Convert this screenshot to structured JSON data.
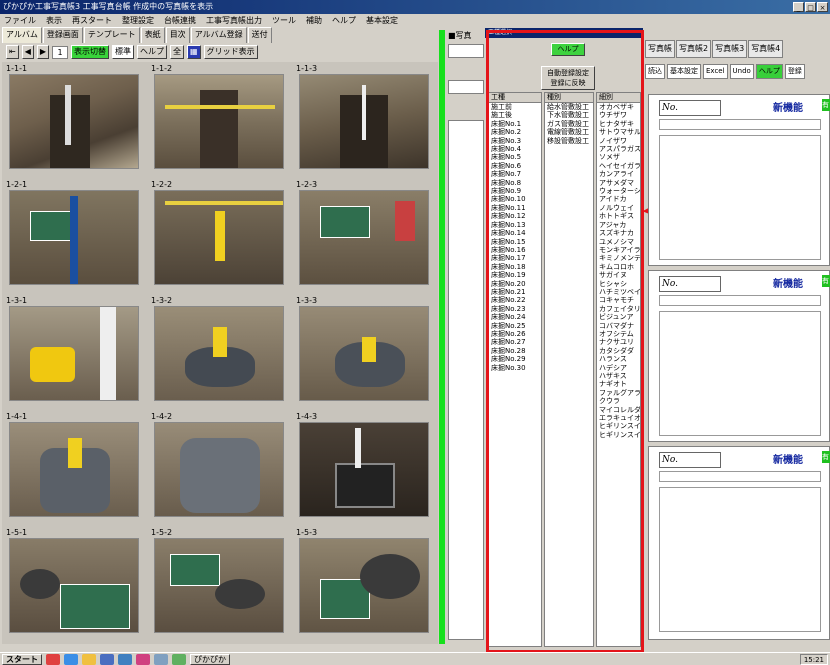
{
  "window": {
    "title": "ぴかぴか工事写真帳3 工事写真台帳 作成中の写真帳を表示"
  },
  "menu": [
    "ファイル",
    "表示",
    "再スタート",
    "整理設定",
    "台帳連携",
    "工事写真帳出力",
    "ツール",
    "補助",
    "ヘルプ",
    "基本設定"
  ],
  "tabs": [
    "アルバム",
    "登録画面",
    "テンプレート",
    "表紙",
    "目次",
    "アルバム登録",
    "送付"
  ],
  "toolbar": {
    "page": "1",
    "green_btn": "表示切替",
    "size": "標準",
    "help": "ヘルプ",
    "all": "全",
    "grid": "グリッド表示"
  },
  "thumbnails": [
    {
      "label": "1-1-1"
    },
    {
      "label": "1-1-2"
    },
    {
      "label": "1-1-3"
    },
    {
      "label": "1-2-1"
    },
    {
      "label": "1-2-2"
    },
    {
      "label": "1-2-3"
    },
    {
      "label": "1-3-1"
    },
    {
      "label": "1-3-2"
    },
    {
      "label": "1-3-3"
    },
    {
      "label": "1-4-1"
    },
    {
      "label": "1-4-2"
    },
    {
      "label": "1-4-3"
    },
    {
      "label": "1-5-1"
    },
    {
      "label": "1-5-2"
    },
    {
      "label": "1-5-3"
    }
  ],
  "mid_panel": {
    "header": "■写真"
  },
  "dialog": {
    "title": "工種選択",
    "help_label": "ヘルプ",
    "auto_label_1": "自動登録設定",
    "auto_label_2": "登録に反映",
    "col1_header": "工種",
    "col2_header": "種別",
    "col3_header": "細別",
    "col1_items": [
      "施工前",
      "施工後",
      "床掘No.1",
      "床掘No.2",
      "床掘No.3",
      "床掘No.4",
      "床掘No.5",
      "床掘No.6",
      "床掘No.7",
      "床掘No.8",
      "床掘No.9",
      "床掘No.10",
      "床掘No.11",
      "床掘No.12",
      "床掘No.13",
      "床掘No.14",
      "床掘No.15",
      "床掘No.16",
      "床掘No.17",
      "床掘No.18",
      "床掘No.19",
      "床掘No.20",
      "床掘No.21",
      "床掘No.22",
      "床掘No.23",
      "床掘No.24",
      "床掘No.25",
      "床掘No.26",
      "床掘No.27",
      "床掘No.28",
      "床掘No.29",
      "床掘No.30"
    ],
    "col2_items": [
      "給水管敷設工",
      "下水管敷設工",
      "ガス管敷設工",
      "電線管敷設工",
      "移設管敷設工"
    ],
    "col3_items": [
      "オカベザキ",
      "ウチザワ",
      "ヒナタザキ",
      "サトウマサル",
      "ノイザワ",
      "アスパラガス",
      "ソメザ",
      "ヘイセイガラス",
      "カンアライ",
      "アサメダマ",
      "ウォーターシュ",
      "アイドカ",
      "ノルウェイ",
      "ホトトギス",
      "アジャカ",
      "スズキナカ",
      "ユメノシマ",
      "モンキアイラ",
      "キミノメンテ",
      "キムコロホ",
      "サガイヌ",
      "ヒシャシ",
      "ハチミツベイ",
      "コキャモチ",
      "カフェイタリア",
      "ビジュンア",
      "コバマダナ",
      "オフシテム",
      "ナクサユリ",
      "カタシダダ",
      "ハランス",
      "ハデシア",
      "ハザキス",
      "ナギオト",
      "ファルグアラン",
      "クウラ",
      "マイコレルダ",
      "エラキュイオ",
      "ヒギリンスイキ",
      "ヒギリンスイキ"
    ]
  },
  "right_panel": {
    "tabs": [
      "写真帳",
      "写真帳2",
      "写真帳3",
      "写真帳4"
    ],
    "buttons": [
      "読込",
      "基本設定",
      "Excel",
      "Undo",
      "ヘルプ",
      "登録"
    ],
    "blocks": [
      {
        "no_label": "No.",
        "newfn": "新機能",
        "flag": "有"
      },
      {
        "no_label": "No.",
        "newfn": "新機能",
        "flag": "有"
      },
      {
        "no_label": "No.",
        "newfn": "新機能",
        "flag": "有"
      }
    ]
  },
  "taskbar": {
    "start": "スタート",
    "clock": "15:21",
    "active_window": "ぴかぴか"
  },
  "colors": {
    "highlight_box": "#e4141a",
    "green": "#16e01d",
    "titlebar": "#0a246a"
  }
}
